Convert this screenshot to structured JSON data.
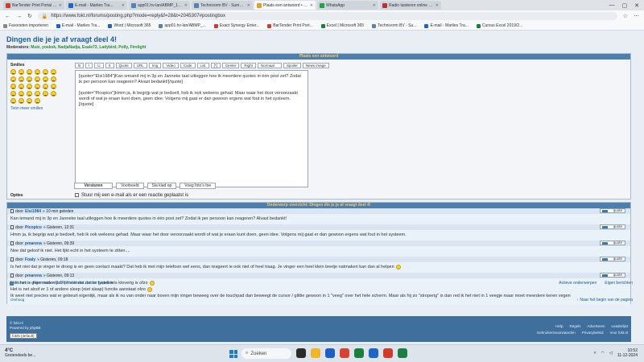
{
  "browser": {
    "tabs": [
      {
        "label": "BarTender Print Portal - Seagull S...",
        "color": "#d33b2f",
        "active": false
      },
      {
        "label": "E-mail - Marlies Tra...",
        "color": "#1c66c4",
        "active": false
      },
      {
        "label": "app01.hv-lan/ABMP_100/A2017/...",
        "color": "#5a7fb5",
        "active": false
      },
      {
        "label": "Technivorm BV - Summit 2022 ...",
        "color": "#5a7fb5",
        "active": false
      },
      {
        "label": "Plaats een antwoord • fokt.nl",
        "color": "#e39e28",
        "active": true
      },
      {
        "label": "WhatsApp",
        "color": "#25a246",
        "active": false
      },
      {
        "label": "Radio luisteren online ~ fm",
        "color": "#c02f2f",
        "active": false
      }
    ],
    "url": "https://www.fokt.nl/forums/posting.php?mode=reply&f=28&t=2045307#postingbox",
    "bookmarks": [
      "Favorieten importeren",
      "E-mail - Marlies Tra...",
      "Word | Microsoft 365",
      "app01.hv-lan/ABMP_...",
      "Exact Synergy Enter...",
      "BarTender Print Port...",
      "Excel | Microsoft 365",
      "Technivorm BV - Su...",
      "E-mail - Marlies Tra...",
      "Cursus Excel 2019/2..."
    ]
  },
  "forum": {
    "title": "Dingen die je je af vraagt deel 4!",
    "moderators_label": "Moderators:",
    "moderators": "Muiz, yoskek, NadjaNadja, Esale73, Ladybird, Polly, Firelight",
    "reply_header": "Plaats een antwoord",
    "smilies_label": "Smilies",
    "more_smilies": "Toon meer smilies",
    "toolbar": [
      "B",
      "I",
      "U",
      "S",
      "Quote",
      "URL",
      "Img",
      "Video",
      "Code",
      "List",
      "[*]",
      "Center",
      "Right",
      "Normaal",
      "Spoiler",
      "News image"
    ],
    "editor_paragraphs": [
      "[quote=\"Elsi1984\"]Kan iemand mij in 3p en Janneke taal uitleggen hoe ik meerdere quotes in één post zet? Zodat ik per persoon kan reageren? Alvast bedankt![/quote]",
      "[quote=\"Picopico\"]Hmm ja, ik begrijp wat je bedoelt, heb ik ook weleens gehad. Maar waar het door veroorzaakt wordt of wat je eraan kunt doen, geen idee. Volgens mij gaat er dan gewoon ergens wat fout in het systeem.[/quote]"
    ],
    "buttons": {
      "submit": "Versturen",
      "preview": "Voorbeeld",
      "save": "Sla klad op",
      "load": "Voeg foto's toe"
    },
    "options_label": "Opties",
    "options_checkbox": "Stuur mij een e-mail als er een reactie geplaatst is",
    "review_header": "Onderwerp overzicht: Dingen die je je af vraagt deel 4!",
    "quote_label": "quote",
    "posts": [
      {
        "author": "Elsi1984",
        "time": "» 10 min geleden",
        "body": [
          "Kan iemand mij in 3p en Janneke taal uitleggen hoe ik meerdere quotes in één post zet? Zodat ik per persoon kan reageren? Alvast bedankt!"
        ]
      },
      {
        "author": "Picopico",
        "time": "» Gisteren, 12:31",
        "body": [
          "Hmm ja, ik begrijp wat je bedoelt, heb ik ook weleens gehad. Maar waar het door veroorzaakt wordt of wat je eraan kunt doen, geen idee. Volgens mij gaat er dan gewoon ergens wat fout in het systeem."
        ]
      },
      {
        "author": "pmarena",
        "time": "» Gisteren, 09:39",
        "body": [
          "Nee dat geloof ik niet. Het lijkt echt in het systeem te zitten...."
        ]
      },
      {
        "author": "Foaly",
        "time": "» Gisteren, 09:18",
        "body": [
          "Is het niet dat je vinger te droog is en geen contact maakt? Dat heb ik met mijn telefoon wel eens, dan reageert ie ook niet of heel traag. Je vinger een heel klein beetje natmaken kan dan al helpen"
        ]
      },
      {
        "author": "pmarena",
        "time": "» Gisteren, 09:13",
        "body": [
          "Nee het is geen nadenken en niet dat dat er fysiek iets kleverig is ofzo",
          "Het is net alsof er 1 of andere sleep (niet slaap) functie aanstaat ofzo",
          "Ik weet niet precies wat er gebeurt eigenlijk, maar als ik nu van onder naar boven mijn vinger beweeg over de touchpad dan beweegt de cursor / glittie gewoon in 1 \"veeg\" over het hele scherm. Maar als hij zo \"stroperig\" is dan red ik het niet in 1 veegje maar moet meerdere keren vegen"
        ]
      }
    ],
    "review_footer": "Omhoog",
    "breadcrumb": [
      "Forum",
      "Algemeen",
      "[LZP] Het leven zonder paarden"
    ],
    "right_links": [
      "Actieve onderwerpen",
      "Eigen berichten"
    ],
    "back_to_top": "↑ Naar het begin van de pagina"
  },
  "footer": {
    "site": "© fokt.nl",
    "powered": "Powered by phpBB",
    "skin": "fokt5 (default)",
    "links1": [
      "Help",
      "Regels",
      "Adverteren",
      "Leaderlijst"
    ],
    "links2": [
      "Gebruikersvoorwaarden",
      "Privacybeleid",
      "Voor fokt.nl"
    ]
  },
  "taskbar": {
    "temp": "4°C",
    "weather": "Grotendeels be...",
    "search": "Zoeken",
    "time": "10:52",
    "date": "11-12-2024",
    "app_colors": [
      "#2b2b2b",
      "#f0b62a",
      "#1d5fc7",
      "#d8432f",
      "#1a7f3c",
      "#1e65c8",
      "#ce3a2c",
      "#1b7f44"
    ]
  }
}
